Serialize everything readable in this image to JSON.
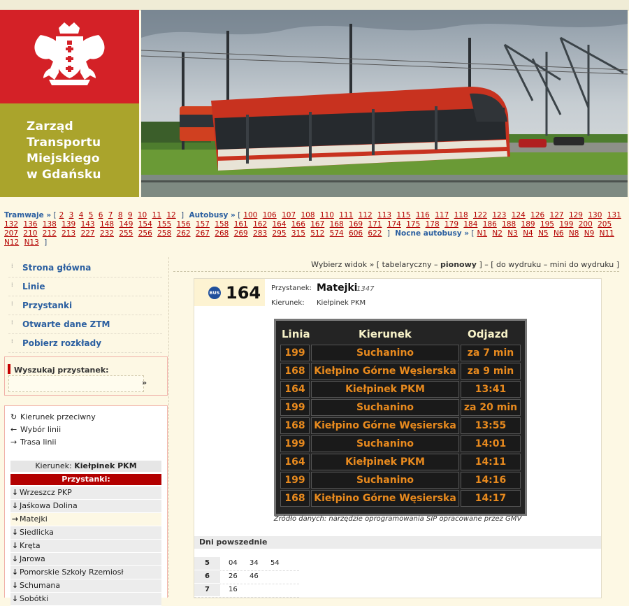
{
  "header": {
    "org_name": "Zarząd\nTransportu\nMiejskiego\nw Gdańsku",
    "logo_icon": "gdansk-coat-of-arms",
    "photo": "tram-in-gdansk"
  },
  "linebar": {
    "tram_label": "Tramwaje »",
    "tram_lines": [
      "2",
      "3",
      "4",
      "5",
      "6",
      "7",
      "8",
      "9",
      "10",
      "11",
      "12"
    ],
    "bus_label": "Autobusy »",
    "bus_lines": [
      "100",
      "106",
      "107",
      "108",
      "110",
      "111",
      "112",
      "113",
      "115",
      "116",
      "117",
      "118",
      "122",
      "123",
      "124",
      "126",
      "127",
      "129",
      "130",
      "131",
      "132",
      "136",
      "138",
      "139",
      "143",
      "148",
      "149",
      "154",
      "155",
      "156",
      "157",
      "158",
      "161",
      "162",
      "164",
      "166",
      "167",
      "168",
      "169",
      "171",
      "174",
      "175",
      "178",
      "179",
      "184",
      "186",
      "188",
      "189",
      "195",
      "199",
      "200",
      "205",
      "207",
      "210",
      "212",
      "213",
      "227",
      "232",
      "255",
      "256",
      "258",
      "262",
      "267",
      "268",
      "269",
      "283",
      "295",
      "315",
      "512",
      "574",
      "606",
      "622"
    ],
    "night_label": "Nocne autobusy »",
    "night_lines": [
      "N1",
      "N2",
      "N3",
      "N4",
      "N5",
      "N6",
      "N8",
      "N9",
      "N11",
      "N12",
      "N13"
    ]
  },
  "nav": [
    "Strona główna",
    "Linie",
    "Przystanki",
    "Otwarte dane ZTM",
    "Pobierz rozkłady"
  ],
  "search": {
    "title": "Wyszukaj przystanek:",
    "go": "»",
    "placeholder": ""
  },
  "route_options": [
    {
      "icon": "reverse-icon",
      "glyph": "↻",
      "label": "Kierunek przeciwny"
    },
    {
      "icon": "arrow-left-icon",
      "glyph": "←",
      "label": "Wybór linii"
    },
    {
      "icon": "arrow-right-icon",
      "glyph": "→",
      "label": "Trasa linii"
    }
  ],
  "direction": {
    "label": "Kierunek:",
    "value": "Kiełpinek PKM"
  },
  "stops_header": "Przystanki:",
  "stops": [
    {
      "name": "Wrzeszcz PKP",
      "arrow": "↓",
      "current": false
    },
    {
      "name": "Jaśkowa Dolina",
      "arrow": "↓",
      "current": false
    },
    {
      "name": "Matejki",
      "arrow": "→",
      "current": true
    },
    {
      "name": "Siedlicka",
      "arrow": "↓",
      "current": false
    },
    {
      "name": "Kręta",
      "arrow": "↓",
      "current": false
    },
    {
      "name": "Jarowa",
      "arrow": "↓",
      "current": false
    },
    {
      "name": "Pomorskie Szkoły Rzemiosł",
      "arrow": "↓",
      "current": false
    },
    {
      "name": "Schumana",
      "arrow": "↓",
      "current": false
    },
    {
      "name": "Sobótki",
      "arrow": "↓",
      "current": false
    }
  ],
  "viewbar": {
    "prefix": "Wybierz widok » [ tabelaryczny – ",
    "active": "pionowy",
    "suffix": " ] – [ do wydruku – mini do wydruku ]"
  },
  "panel": {
    "bus_icon_text": "BUS",
    "line": "164",
    "stop_label": "Przystanek:",
    "stop_name": "Matejki",
    "stop_code": "1347",
    "dir_label": "Kierunek:",
    "dir_value": "Kiełpinek PKM"
  },
  "board": {
    "headers": [
      "Linia",
      "Kierunek",
      "Odjazd"
    ],
    "rows": [
      [
        "199",
        "Suchanino",
        "za 7 min"
      ],
      [
        "168",
        "Kiełpino Górne Węsierska",
        "za 9 min"
      ],
      [
        "164",
        "Kiełpinek PKM",
        "13:41"
      ],
      [
        "199",
        "Suchanino",
        "za 20 min"
      ],
      [
        "168",
        "Kiełpino Górne Węsierska",
        "13:55"
      ],
      [
        "199",
        "Suchanino",
        "14:01"
      ],
      [
        "164",
        "Kiełpinek PKM",
        "14:11"
      ],
      [
        "199",
        "Suchanino",
        "14:16"
      ],
      [
        "168",
        "Kiełpino Górne Węsierska",
        "14:17"
      ]
    ],
    "source": "Źródło danych: narzędzie oprogramowania SIP opracowane przez GMV"
  },
  "timetable": {
    "days_label": "Dni powszednie",
    "rows": [
      {
        "hour": "5",
        "minutes": [
          "04",
          "34",
          "54"
        ]
      },
      {
        "hour": "6",
        "minutes": [
          "26",
          "46"
        ]
      },
      {
        "hour": "7",
        "minutes": [
          "16"
        ]
      }
    ]
  }
}
